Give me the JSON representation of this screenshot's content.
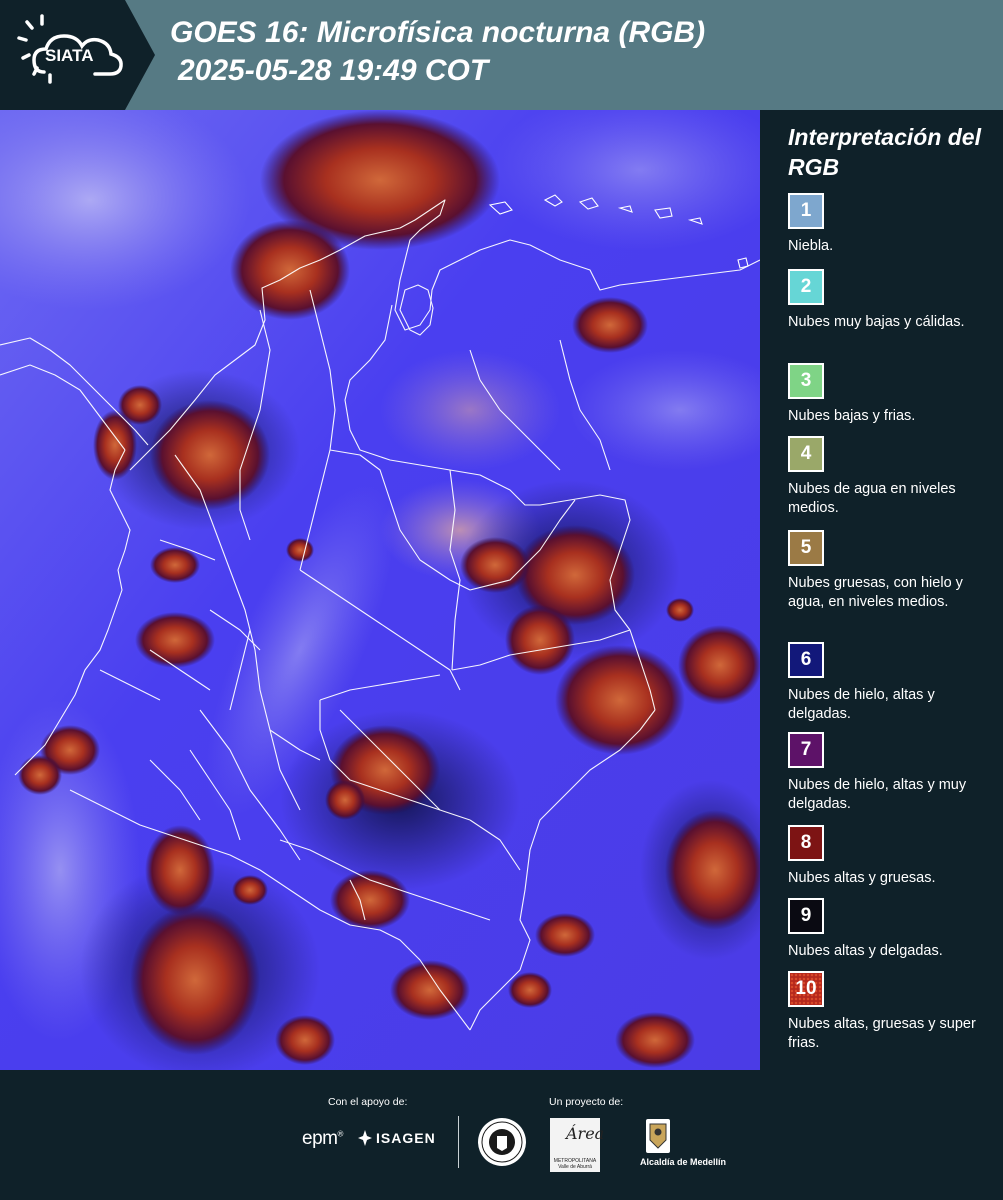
{
  "header": {
    "logo_text": "SIATA",
    "title_line1": "GOES 16: Microfísica nocturna (RGB)",
    "title_line2": "2025-05-28 19:49 COT",
    "background_color": "#567a84"
  },
  "legend": {
    "title": "Interpretación del RGB",
    "items": [
      {
        "number": "1",
        "color": "#7ea7ce",
        "description": "Niebla."
      },
      {
        "number": "2",
        "color": "#66d6d6",
        "description": "Nubes muy bajas y cálidas."
      },
      {
        "number": "3",
        "color": "#7fd486",
        "description": "Nubes bajas y frias."
      },
      {
        "number": "4",
        "color": "#9aa869",
        "description": "Nubes de agua en niveles medios."
      },
      {
        "number": "5",
        "color": "#9b7a45",
        "description": "Nubes gruesas, con hielo y agua, en niveles medios."
      },
      {
        "number": "6",
        "color": "#12187a",
        "description": "Nubes de hielo, altas y delgadas."
      },
      {
        "number": "7",
        "color": "#5d1268",
        "description": "Nubes de hielo, altas y muy delgadas."
      },
      {
        "number": "8",
        "color": "#7d1414",
        "description": "Nubes altas y gruesas."
      },
      {
        "number": "9",
        "color": "#0a0a12",
        "description": "Nubes altas y delgadas."
      },
      {
        "number": "10",
        "color": "#b5281c",
        "description": "Nubes altas, gruesas y super frias."
      }
    ]
  },
  "footer": {
    "support_label": "Con el apoyo de:",
    "project_label": "Un proyecto de:",
    "epm": "epm",
    "isagen": "ISAGEN",
    "area_logo": "Área",
    "area_subtitle": "METROPOLITANA Valle de Aburrá",
    "alcaldia": "Alcaldía de Medellín"
  },
  "map": {
    "background_color": "#4b3ff0",
    "border_color": "#ffffff"
  }
}
